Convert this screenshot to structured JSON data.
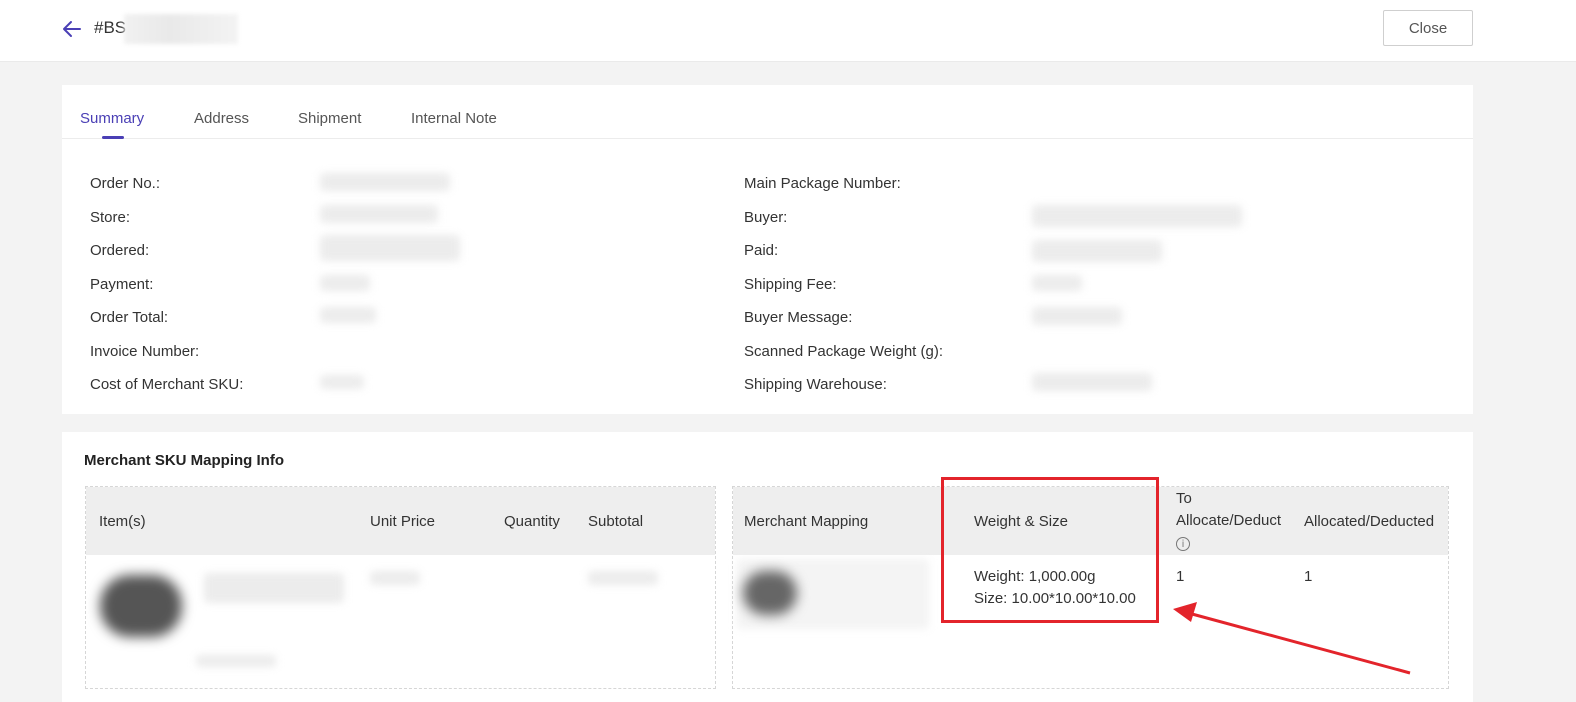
{
  "header": {
    "order_prefix": "#BS",
    "close_label": "Close"
  },
  "tabs": [
    {
      "label": "Summary",
      "active": true
    },
    {
      "label": "Address",
      "active": false
    },
    {
      "label": "Shipment",
      "active": false
    },
    {
      "label": "Internal Note",
      "active": false
    }
  ],
  "summary": {
    "left_fields": [
      "Order No.:",
      "Store:",
      "Ordered:",
      "Payment:",
      "Order Total:",
      "Invoice Number:",
      "Cost of Merchant SKU:"
    ],
    "right_fields": [
      "Main Package Number:",
      "Buyer:",
      "Paid:",
      "Shipping Fee:",
      "Buyer Message:",
      "Scanned Package Weight (g):",
      "Shipping Warehouse:"
    ]
  },
  "mapping": {
    "title": "Merchant SKU Mapping Info",
    "left_columns": [
      "Item(s)",
      "Unit Price",
      "Quantity",
      "Subtotal"
    ],
    "right_columns": {
      "merchant_mapping": "Merchant Mapping",
      "weight_size": "Weight & Size",
      "to_allocate_line1": "To",
      "to_allocate_line2": "Allocate/Deduct",
      "allocated": "Allocated/Deducted"
    },
    "row": {
      "weight": "Weight: 1,000.00g",
      "size": "Size: 10.00*10.00*10.00",
      "to_allocate": "1",
      "allocated": "1"
    }
  },
  "colors": {
    "accent": "#4a3fb5",
    "annotation": "#e3242b"
  },
  "icons": {
    "back": "arrow-left-icon",
    "info": "info-circle-icon"
  }
}
